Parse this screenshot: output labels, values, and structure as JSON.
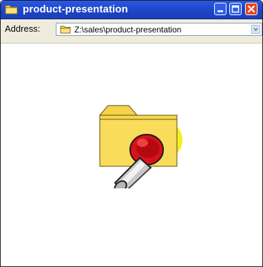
{
  "window": {
    "title": "product-presentation",
    "title_icon": "folder-icon",
    "controls": [
      "minimize-icon",
      "maximize-icon",
      "close-icon"
    ]
  },
  "address_bar": {
    "label": "Address:",
    "path": "Z:\\sales\\product-presentation",
    "path_icon": "folder-icon",
    "dropdown_icon": "chevron-down-icon"
  },
  "content": {
    "item_icon": "folder-with-plunger-icon"
  },
  "colors": {
    "titlebar": "#1d45c6",
    "close_button": "#e8431c",
    "addressbar_bg": "#f0ecdd",
    "folder_fill": "#f7d64a",
    "plunger_red": "#d9111a"
  }
}
